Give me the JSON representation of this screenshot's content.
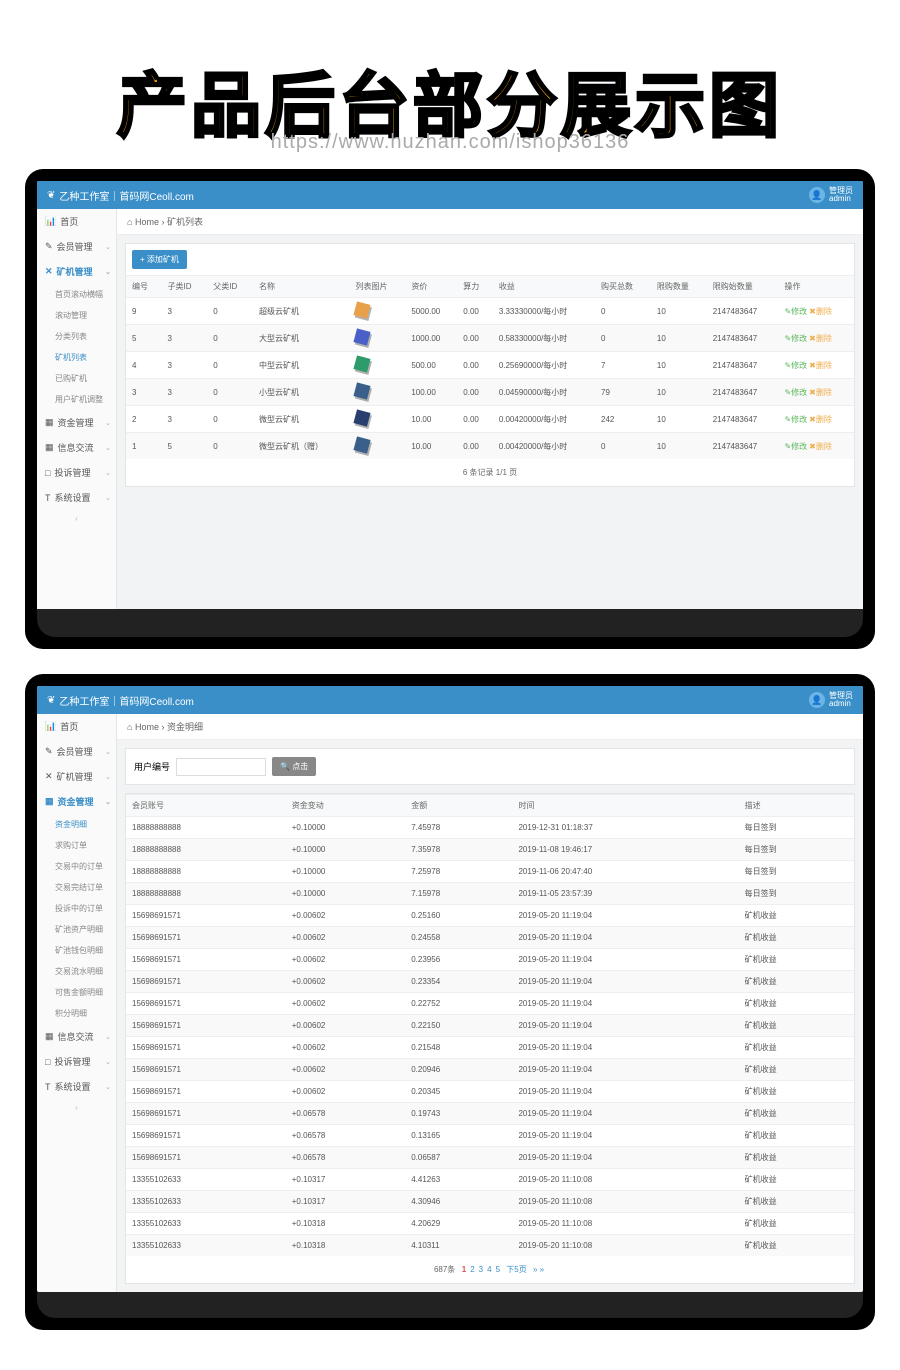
{
  "title": "产品后台部分展示图",
  "watermark": "https://www.huzhan.com/ishop36136",
  "brand": "乙种工作室｜首码网Ceoll.com",
  "admin": {
    "role": "管理员",
    "name": "admin"
  },
  "crumb_home": "Home",
  "screen1": {
    "crumb": "矿机列表",
    "addBtn": "+ 添加矿机",
    "sidebar": [
      {
        "icon": "📊",
        "label": "首页",
        "chev": ""
      },
      {
        "icon": "✎",
        "label": "会员管理",
        "chev": "⌄"
      },
      {
        "icon": "✕",
        "label": "矿机管理",
        "chev": "⌄",
        "active": true
      },
      {
        "sub": true,
        "label": "首页滚动横幅"
      },
      {
        "sub": true,
        "label": "滚动管理"
      },
      {
        "sub": true,
        "label": "分类列表"
      },
      {
        "sub": true,
        "label": "矿机列表",
        "active": true
      },
      {
        "sub": true,
        "label": "已购矿机"
      },
      {
        "sub": true,
        "label": "用户矿机调整"
      },
      {
        "icon": "▦",
        "label": "资金管理",
        "chev": "⌄"
      },
      {
        "icon": "▦",
        "label": "信息交流",
        "chev": "⌄"
      },
      {
        "icon": "□",
        "label": "投诉管理",
        "chev": "⌄"
      },
      {
        "icon": "T",
        "label": "系统设置",
        "chev": "⌄"
      }
    ],
    "headers": [
      "编号",
      "子类ID",
      "父类ID",
      "名称",
      "列表图片",
      "资价",
      "算力",
      "收益",
      "购买总数",
      "限购数量",
      "限购始数量",
      "操作"
    ],
    "rows": [
      {
        "id": "9",
        "sub": "3",
        "par": "0",
        "name": "超级云矿机",
        "color": "#e8a04a",
        "price": "5000.00",
        "power": "0.00",
        "earn": "3.33330000/每小时",
        "total": "0",
        "limit": "10",
        "start": "2147483647"
      },
      {
        "id": "5",
        "sub": "3",
        "par": "0",
        "name": "大型云矿机",
        "color": "#4a5fc8",
        "price": "1000.00",
        "power": "0.00",
        "earn": "0.58330000/每小时",
        "total": "0",
        "limit": "10",
        "start": "2147483647"
      },
      {
        "id": "4",
        "sub": "3",
        "par": "0",
        "name": "中型云矿机",
        "color": "#2e9b6b",
        "price": "500.00",
        "power": "0.00",
        "earn": "0.25690000/每小时",
        "total": "7",
        "limit": "10",
        "start": "2147483647"
      },
      {
        "id": "3",
        "sub": "3",
        "par": "0",
        "name": "小型云矿机",
        "color": "#3a5f8a",
        "price": "100.00",
        "power": "0.00",
        "earn": "0.04590000/每小时",
        "total": "79",
        "limit": "10",
        "start": "2147483647"
      },
      {
        "id": "2",
        "sub": "3",
        "par": "0",
        "name": "微型云矿机",
        "color": "#2a3f6f",
        "price": "10.00",
        "power": "0.00",
        "earn": "0.00420000/每小时",
        "total": "242",
        "limit": "10",
        "start": "2147483647"
      },
      {
        "id": "1",
        "sub": "5",
        "par": "0",
        "name": "微型云矿机（赠）",
        "color": "#3a5f8a",
        "price": "10.00",
        "power": "0.00",
        "earn": "0.00420000/每小时",
        "total": "0",
        "limit": "10",
        "start": "2147483647"
      }
    ],
    "opEdit": "✎修改",
    "opDel": "✖删除",
    "footer": "6 条记录 1/1 页"
  },
  "screen2": {
    "crumb": "资金明细",
    "searchLabel": "用户编号",
    "searchBtn": "🔍 点击",
    "sidebar": [
      {
        "icon": "📊",
        "label": "首页",
        "chev": ""
      },
      {
        "icon": "✎",
        "label": "会员管理",
        "chev": "⌄"
      },
      {
        "icon": "✕",
        "label": "矿机管理",
        "chev": "⌄"
      },
      {
        "icon": "▦",
        "label": "资金管理",
        "chev": "⌄",
        "active": true
      },
      {
        "sub": true,
        "label": "资金明细",
        "active": true
      },
      {
        "sub": true,
        "label": "求购订单"
      },
      {
        "sub": true,
        "label": "交易中的订单"
      },
      {
        "sub": true,
        "label": "交易完结订单"
      },
      {
        "sub": true,
        "label": "投诉中的订单"
      },
      {
        "sub": true,
        "label": "矿池资产明细"
      },
      {
        "sub": true,
        "label": "矿池钱包明细"
      },
      {
        "sub": true,
        "label": "交易流水明细"
      },
      {
        "sub": true,
        "label": "可售金额明细"
      },
      {
        "sub": true,
        "label": "积分明细"
      },
      {
        "icon": "▦",
        "label": "信息交流",
        "chev": "⌄"
      },
      {
        "icon": "□",
        "label": "投诉管理",
        "chev": "⌄"
      },
      {
        "icon": "T",
        "label": "系统设置",
        "chev": "⌄"
      }
    ],
    "headers": [
      "会员账号",
      "资金变动",
      "金额",
      "时间",
      "描述"
    ],
    "rows": [
      {
        "acc": "18888888888",
        "chg": "+0.10000",
        "amt": "7.45978",
        "time": "2019-12-31 01:18:37",
        "desc": "每日签到"
      },
      {
        "acc": "18888888888",
        "chg": "+0.10000",
        "amt": "7.35978",
        "time": "2019-11-08 19:46:17",
        "desc": "每日签到"
      },
      {
        "acc": "18888888888",
        "chg": "+0.10000",
        "amt": "7.25978",
        "time": "2019-11-06 20:47:40",
        "desc": "每日签到"
      },
      {
        "acc": "18888888888",
        "chg": "+0.10000",
        "amt": "7.15978",
        "time": "2019-11-05 23:57:39",
        "desc": "每日签到"
      },
      {
        "acc": "15698691571",
        "chg": "+0.00602",
        "amt": "0.25160",
        "time": "2019-05-20 11:19:04",
        "desc": "矿机收益"
      },
      {
        "acc": "15698691571",
        "chg": "+0.00602",
        "amt": "0.24558",
        "time": "2019-05-20 11:19:04",
        "desc": "矿机收益"
      },
      {
        "acc": "15698691571",
        "chg": "+0.00602",
        "amt": "0.23956",
        "time": "2019-05-20 11:19:04",
        "desc": "矿机收益"
      },
      {
        "acc": "15698691571",
        "chg": "+0.00602",
        "amt": "0.23354",
        "time": "2019-05-20 11:19:04",
        "desc": "矿机收益"
      },
      {
        "acc": "15698691571",
        "chg": "+0.00602",
        "amt": "0.22752",
        "time": "2019-05-20 11:19:04",
        "desc": "矿机收益"
      },
      {
        "acc": "15698691571",
        "chg": "+0.00602",
        "amt": "0.22150",
        "time": "2019-05-20 11:19:04",
        "desc": "矿机收益"
      },
      {
        "acc": "15698691571",
        "chg": "+0.00602",
        "amt": "0.21548",
        "time": "2019-05-20 11:19:04",
        "desc": "矿机收益"
      },
      {
        "acc": "15698691571",
        "chg": "+0.00602",
        "amt": "0.20946",
        "time": "2019-05-20 11:19:04",
        "desc": "矿机收益"
      },
      {
        "acc": "15698691571",
        "chg": "+0.00602",
        "amt": "0.20345",
        "time": "2019-05-20 11:19:04",
        "desc": "矿机收益"
      },
      {
        "acc": "15698691571",
        "chg": "+0.06578",
        "amt": "0.19743",
        "time": "2019-05-20 11:19:04",
        "desc": "矿机收益"
      },
      {
        "acc": "15698691571",
        "chg": "+0.06578",
        "amt": "0.13165",
        "time": "2019-05-20 11:19:04",
        "desc": "矿机收益"
      },
      {
        "acc": "15698691571",
        "chg": "+0.06578",
        "amt": "0.06587",
        "time": "2019-05-20 11:19:04",
        "desc": "矿机收益"
      },
      {
        "acc": "13355102633",
        "chg": "+0.10317",
        "amt": "4.41263",
        "time": "2019-05-20 11:10:08",
        "desc": "矿机收益"
      },
      {
        "acc": "13355102633",
        "chg": "+0.10317",
        "amt": "4.30946",
        "time": "2019-05-20 11:10:08",
        "desc": "矿机收益"
      },
      {
        "acc": "13355102633",
        "chg": "+0.10318",
        "amt": "4.20629",
        "time": "2019-05-20 11:10:08",
        "desc": "矿机收益"
      },
      {
        "acc": "13355102633",
        "chg": "+0.10318",
        "amt": "4.10311",
        "time": "2019-05-20 11:10:08",
        "desc": "矿机收益"
      }
    ],
    "pagination": {
      "total": "687条",
      "pages": [
        "1",
        "2",
        "3",
        "4",
        "5"
      ],
      "next": "下5页",
      "end": "» »"
    }
  }
}
